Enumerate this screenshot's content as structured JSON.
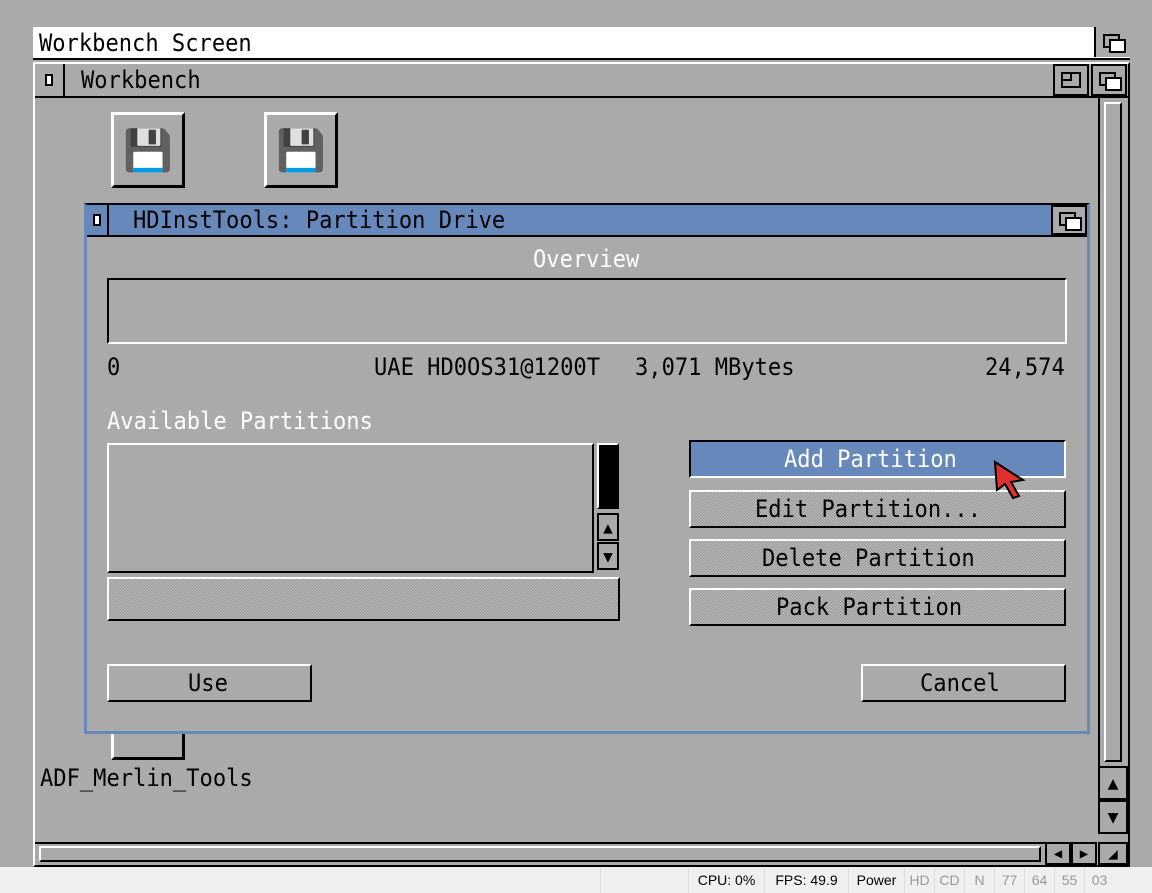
{
  "screen": {
    "title": "Workbench Screen"
  },
  "workbench": {
    "title": "Workbench",
    "icons": [
      {
        "label": "ADF_Merlin_Tools"
      }
    ]
  },
  "dialog": {
    "title": "HDInstTools: Partition Drive",
    "overview_label": "Overview",
    "range_start": "0",
    "drive_name": "UAE HD0OS31@1200T",
    "drive_size": "3,071 MBytes",
    "range_end": "24,574",
    "available_label": "Available Partitions",
    "partitions": [],
    "buttons": {
      "add": "Add Partition",
      "edit": "Edit Partition...",
      "delete": "Delete Partition",
      "pack": "Pack Partition",
      "use": "Use",
      "cancel": "Cancel"
    }
  },
  "statusbar": {
    "cpu": "CPU: 0%",
    "fps": "FPS: 49.9",
    "power": "Power",
    "hd": "HD",
    "cd": "CD",
    "n": "N",
    "d1": "77",
    "d2": "64",
    "d3": "55",
    "d4": "03"
  },
  "colors": {
    "accent": "#6688bb",
    "background": "#aaaaaa"
  }
}
